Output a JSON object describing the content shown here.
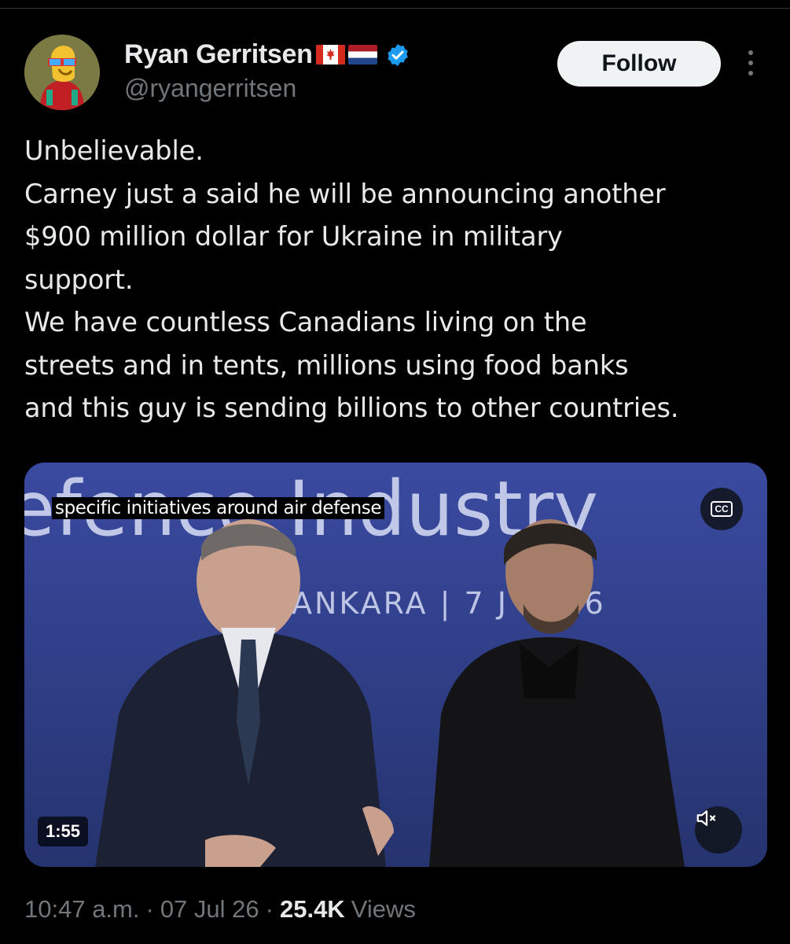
{
  "author": {
    "name": "Ryan Gerritsen",
    "handle": "@ryangerritsen",
    "flags": [
      "canada-flag",
      "netherlands-flag"
    ],
    "verified": true,
    "verified_color": "#1d9bf0"
  },
  "actions": {
    "follow_label": "Follow"
  },
  "tweet": {
    "lines": [
      "Unbelievable.",
      "Carney just a said he will be announcing another",
      "$900 million dollar for Ukraine in military",
      "support.",
      "We have countless Canadians living on the",
      "streets and in tents, millions using food banks",
      "and this guy is sending billions to other countries."
    ]
  },
  "media": {
    "caption": "specific initiatives around air defense",
    "cc_label": "CC",
    "duration": "1:55",
    "background_text": "efence Industry",
    "background_subtext": "ANKARA | 7 J     2026"
  },
  "meta": {
    "time": "10:47 a.m.",
    "separator": "·",
    "date": "07 Jul 26",
    "views_count": "25.4K",
    "views_label": "Views"
  },
  "colors": {
    "background": "#000000",
    "text": "#e7e9ea",
    "muted": "#71767b",
    "accent": "#1d9bf0",
    "media_backdrop": "#2d3a86"
  }
}
